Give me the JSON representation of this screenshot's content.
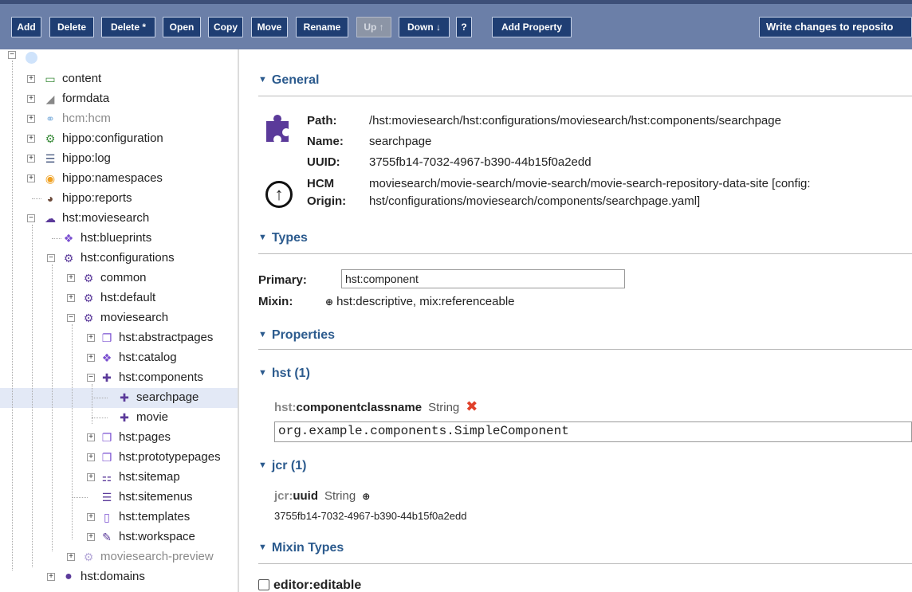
{
  "toolbar": {
    "add": "Add",
    "delete": "Delete",
    "delete_star": "Delete *",
    "open": "Open",
    "copy": "Copy",
    "move": "Move",
    "rename": "Rename",
    "up": "Up ↑",
    "down": "Down ↓",
    "help": "?",
    "add_property": "Add Property",
    "write": "Write changes to reposito"
  },
  "tree": {
    "root_icon": "circle-icon",
    "nodes": {
      "content": "content",
      "formdata": "formdata",
      "hcm": "hcm:hcm",
      "hippo_configuration": "hippo:configuration",
      "hippo_log": "hippo:log",
      "hippo_namespaces": "hippo:namespaces",
      "hippo_reports": "hippo:reports",
      "hst_moviesearch": "hst:moviesearch",
      "hst_blueprints": "hst:blueprints",
      "hst_configurations": "hst:configurations",
      "common": "common",
      "hst_default": "hst:default",
      "moviesearch": "moviesearch",
      "hst_abstractpages": "hst:abstractpages",
      "hst_catalog": "hst:catalog",
      "hst_components": "hst:components",
      "searchpage": "searchpage",
      "movie": "movie",
      "hst_pages": "hst:pages",
      "hst_prototypepages": "hst:prototypepages",
      "hst_sitemap": "hst:sitemap",
      "hst_sitemenus": "hst:sitemenus",
      "hst_templates": "hst:templates",
      "hst_workspace": "hst:workspace",
      "moviesearch_preview": "moviesearch-preview",
      "hst_domains": "hst:domains"
    }
  },
  "general": {
    "heading": "General",
    "path_label": "Path:",
    "path_value": "/hst:moviesearch/hst:configurations/moviesearch/hst:components/searchpage",
    "name_label": "Name:",
    "name_value": "searchpage",
    "uuid_label": "UUID:",
    "uuid_value": "3755fb14-7032-4967-b390-44b15f0a2edd",
    "hcm_label_1": "HCM",
    "hcm_label_2": "Origin:",
    "hcm_value_1": "moviesearch/movie-search/movie-search/movie-search-repository-data-site [config:",
    "hcm_value_2": "hst/configurations/moviesearch/components/searchpage.yaml]"
  },
  "types": {
    "heading": "Types",
    "primary_label": "Primary:",
    "primary_value": "hst:component",
    "mixin_label": "Mixin:",
    "mixin_value": "hst:descriptive, mix:referenceable"
  },
  "properties": {
    "heading": "Properties",
    "hst_group": "hst (1)",
    "hst_prop_ns": "hst:",
    "hst_prop_local": "componentclassname",
    "hst_prop_type": "String",
    "hst_prop_value": "org.example.components.SimpleComponent",
    "jcr_group": "jcr (1)",
    "jcr_prop_ns": "jcr:",
    "jcr_prop_local": "uuid",
    "jcr_prop_type": "String",
    "jcr_prop_value": "3755fb14-7032-4967-b390-44b15f0a2edd"
  },
  "mixin_types": {
    "heading": "Mixin Types",
    "editor_editable": "editor:editable"
  },
  "colors": {
    "toolbar_bg": "#6b7fa8",
    "button_bg": "#1f3e73",
    "section_heading": "#2c5b8e",
    "selected_row": "#e3e9f6",
    "delete_x": "#e0402a"
  }
}
